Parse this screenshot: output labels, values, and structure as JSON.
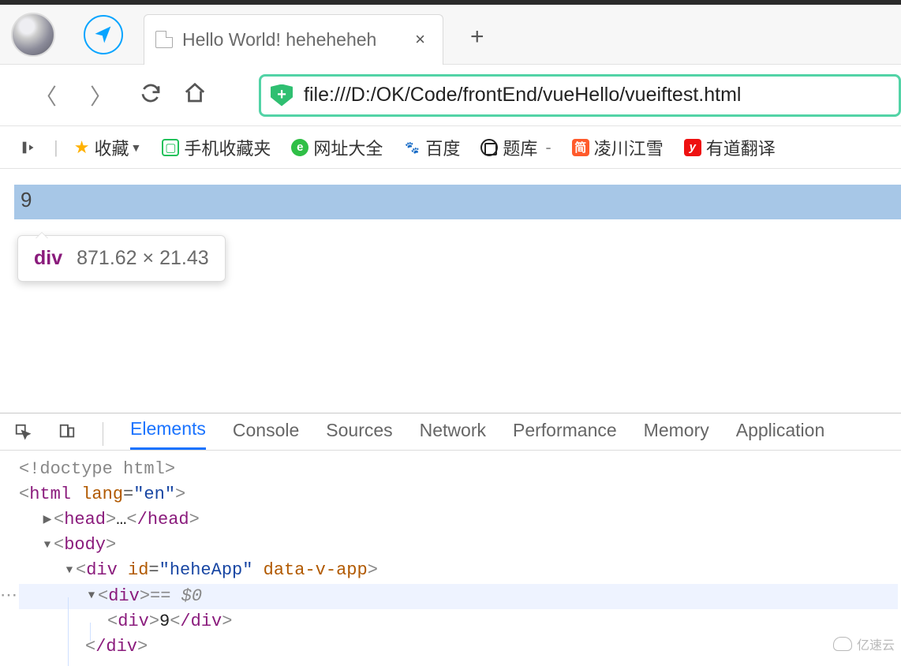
{
  "titlebar": {
    "tab_title": "Hello World! heheheheh",
    "tab_close": "×",
    "newtab": "+"
  },
  "navrow": {
    "back": "〈",
    "forward": "〉",
    "url": "file:///D:/OK/Code/frontEnd/vueHello/vueiftest.html",
    "shield_glyph": "+"
  },
  "bookmarks": {
    "sidebar_glyph": "▎▸",
    "sep": "|",
    "fav": "收藏",
    "mobile_fav": "手机收藏夹",
    "site_all": "网址大全",
    "baidu": "百度",
    "tiku": "题库",
    "tiku_dash": "-",
    "lingchuan": "凌川江雪",
    "youdao": "有道翻译",
    "jian_glyph": "简",
    "y_glyph": "y",
    "paw_glyph": "🐾",
    "sq_glyph": "▢",
    "san60_glyph": "e"
  },
  "page": {
    "highlight_value": "9",
    "tooltip_tag": "div",
    "tooltip_dims": "871.62 × 21.43"
  },
  "devtools": {
    "tabs": {
      "elements": "Elements",
      "console": "Console",
      "sources": "Sources",
      "network": "Network",
      "performance": "Performance",
      "memory": "Memory",
      "application": "Application"
    },
    "code": {
      "doctype": "<!doctype html>",
      "html_open_pre": "<",
      "html_tag": "html",
      "html_attr": "lang",
      "html_attr_val": "\"en\"",
      "gt": ">",
      "head_open": "head",
      "head_ell": "…",
      "head_close": "/head",
      "body": "body",
      "div": "div",
      "id_attr": "id",
      "id_val": "\"heheApp\"",
      "datavapp": "data-v-app",
      "eq": "=",
      "sel_suffix": " == $0",
      "inner_text": "9",
      "slashdiv": "/div"
    }
  },
  "watermark": "亿速云"
}
